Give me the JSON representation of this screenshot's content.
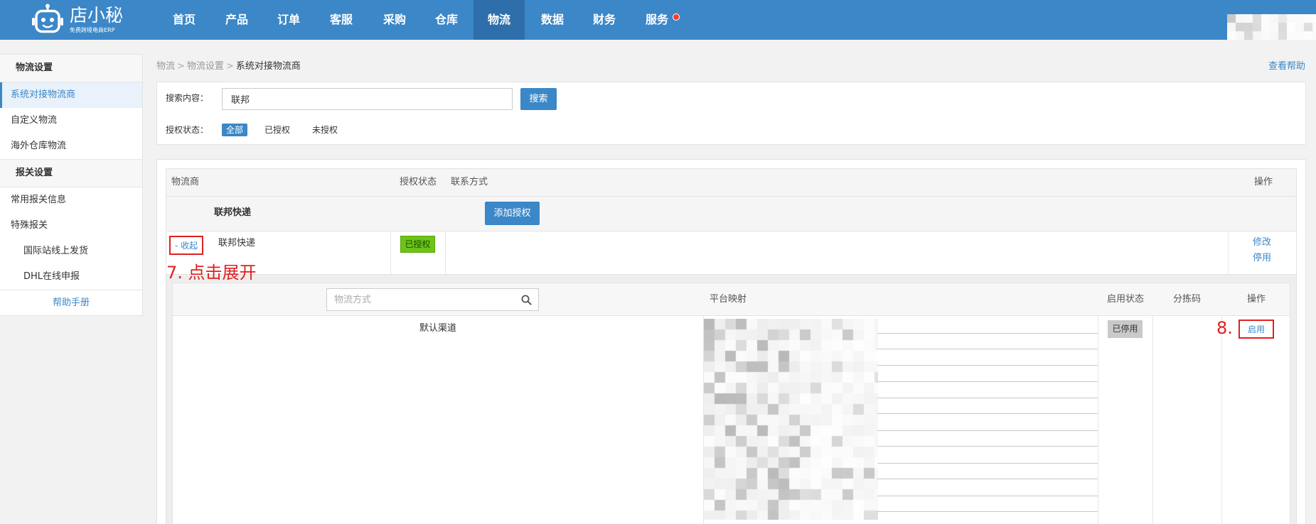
{
  "colors": {
    "primary": "#3c87c8",
    "nav_active": "#2e6fab",
    "annotation": "#e02020",
    "authorized": "#6cc417",
    "disabled_badge": "#c9c9c9",
    "notification": "#ff3b30",
    "link": "#3c87c8"
  },
  "brand": {
    "name": "店小秘",
    "tagline": "免费跨境电商ERP",
    "logo_icon": "robot-icon"
  },
  "nav": {
    "items": [
      "首页",
      "产品",
      "订单",
      "客服",
      "采购",
      "仓库",
      "物流",
      "数据",
      "财务",
      "服务"
    ],
    "active_index": 6,
    "notification_index": 9
  },
  "user": {
    "redacted": true
  },
  "sidebar": {
    "sections": [
      {
        "title": "物流设置",
        "items": [
          {
            "label": "系统对接物流商",
            "active": true
          },
          {
            "label": "自定义物流"
          },
          {
            "label": "海外仓库物流"
          }
        ]
      },
      {
        "title": "报关设置",
        "items": [
          {
            "label": "常用报关信息"
          },
          {
            "label": "特殊报关"
          },
          {
            "label": "国际站线上发货",
            "indent": true
          },
          {
            "label": "DHL在线申报",
            "indent": true
          }
        ]
      }
    ],
    "help": "帮助手册"
  },
  "breadcrumb": {
    "items": [
      "物流",
      "物流设置",
      "系统对接物流商"
    ],
    "separator": ">"
  },
  "help_link": "查看帮助",
  "search": {
    "label": "搜索内容：",
    "value": "联邦",
    "button": "搜索"
  },
  "auth_filter": {
    "label": "授权状态：",
    "options": [
      "全部",
      "已授权",
      "未授权"
    ],
    "selected_index": 0
  },
  "carrier_table": {
    "headers": {
      "carrier": "物流商",
      "auth_status": "授权状态",
      "contact": "联系方式",
      "actions": "操作"
    },
    "groups": [
      {
        "name": "联邦快递",
        "add_button": "添加授权",
        "accounts": [
          {
            "toggle": "- 收起",
            "name": "联邦快递",
            "auth_status": "已授权",
            "contact": "",
            "actions": [
              "修改",
              "停用"
            ],
            "expanded": true
          }
        ]
      }
    ]
  },
  "channel_table": {
    "search_placeholder": "物流方式",
    "search_icon": "search-icon",
    "headers": {
      "mapping": "平台映射",
      "enabled_status": "启用状态",
      "sort_code": "分拣码",
      "actions": "操作"
    },
    "rows": [
      {
        "channel": "默认渠道",
        "mapping_redacted": true,
        "enabled_status": "已停用",
        "sort_code": "",
        "action": "启用"
      }
    ]
  },
  "annotations": {
    "step7": "7. 点击展开",
    "step8": "8."
  }
}
